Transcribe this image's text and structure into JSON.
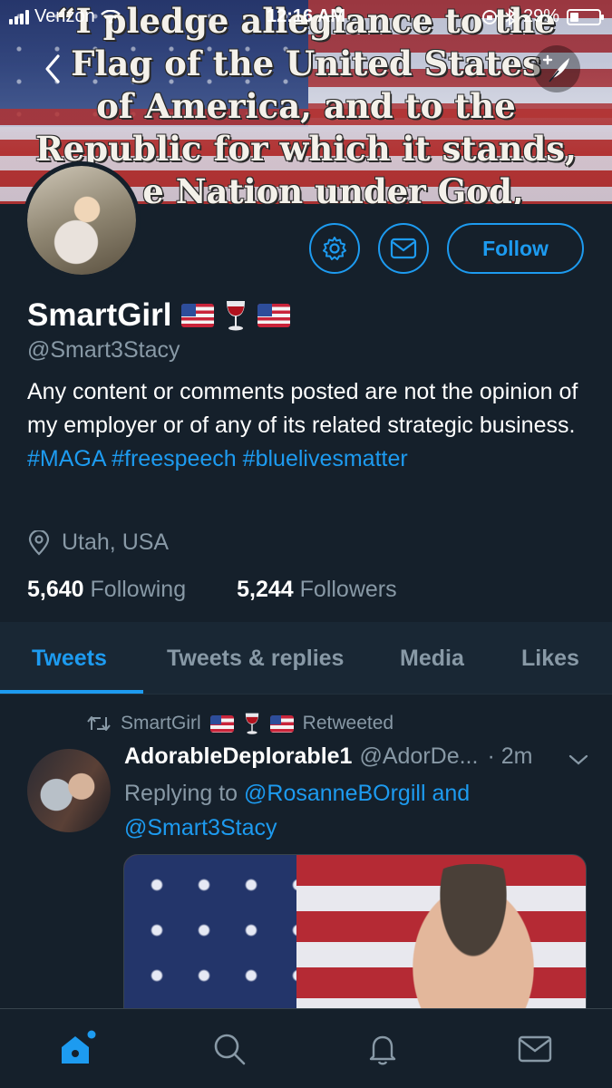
{
  "status_bar": {
    "carrier": "Verizon",
    "time": "12:16 AM",
    "battery": "29%",
    "battery_level": 0.29
  },
  "banner": {
    "quote_lines": [
      "“I pledge allegiance to the",
      "Flag of the United States",
      "of America, and to the",
      "Republic for which it stands,",
      "e Nation under God,"
    ]
  },
  "profile": {
    "display_name": "SmartGirl",
    "handle": "@Smart3Stacy",
    "bio_text": "Any content or comments posted are not the opinion of my employer or of any of its related strategic business.",
    "bio_tags": [
      "#MAGA",
      "#freespeech",
      "#bluelivesmatter"
    ],
    "location": "Utah, USA",
    "following_count": "5,640",
    "following_label": "Following",
    "followers_count": "5,244",
    "followers_label": "Followers",
    "follow_button": "Follow"
  },
  "tabs": [
    {
      "label": "Tweets",
      "active": true
    },
    {
      "label": "Tweets & replies",
      "active": false
    },
    {
      "label": "Media",
      "active": false
    },
    {
      "label": "Likes",
      "active": false
    }
  ],
  "tweet": {
    "retweeted_by": "SmartGirl",
    "retweeted_label": "Retweeted",
    "author_name": "AdorableDeplorable1",
    "author_handle": "@AdorDe...",
    "time": "· 2m",
    "replying_prefix": "Replying to",
    "replying_mention_1": "@RosanneBOrgill",
    "replying_and": "and",
    "replying_mention_2": "@Smart3Stacy"
  },
  "colors": {
    "background": "#15202b",
    "accent": "#1d9bf0",
    "muted": "#8899a6"
  },
  "bottom_nav": [
    "home-icon",
    "search-icon",
    "bell-icon",
    "mail-icon"
  ]
}
